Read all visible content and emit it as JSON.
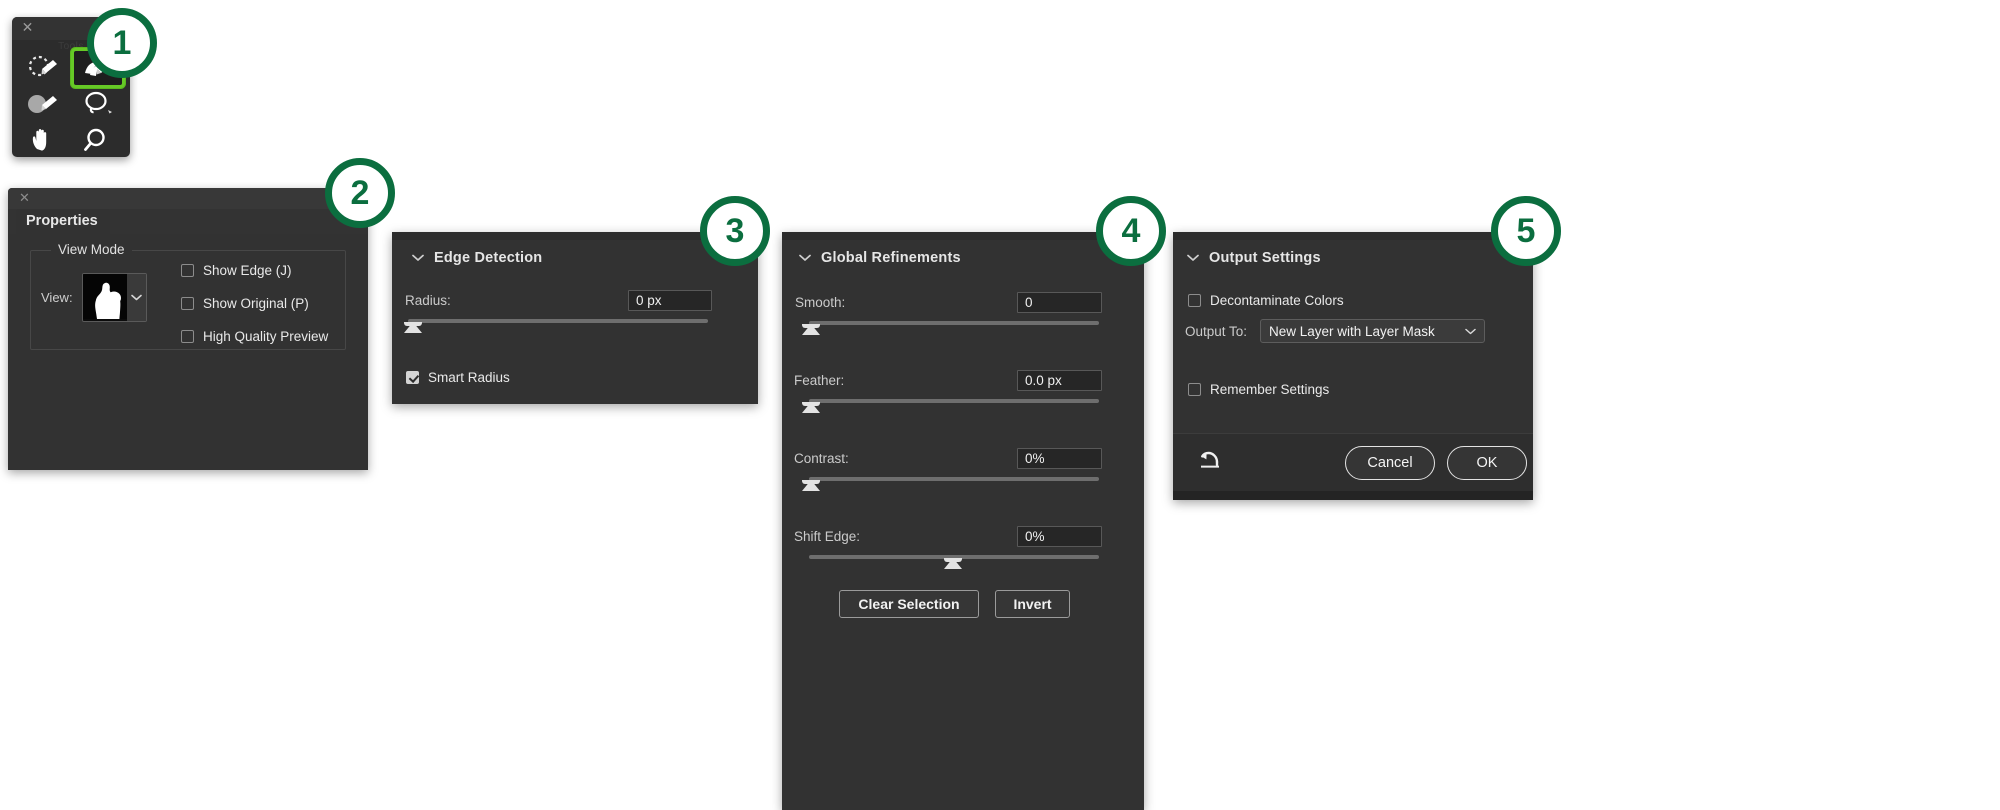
{
  "toolbar": {
    "title": "Tools",
    "close_icon": "close-icon",
    "collapse_icon": "chevron-left-icon",
    "tools": [
      {
        "name": "quick-selection-tool",
        "selected": false
      },
      {
        "name": "refine-edge-brush-tool",
        "selected": true
      },
      {
        "name": "brush-tool",
        "selected": false
      },
      {
        "name": "lasso-tool",
        "selected": false
      },
      {
        "name": "hand-tool",
        "selected": false
      },
      {
        "name": "zoom-tool",
        "selected": false
      }
    ]
  },
  "properties": {
    "close_icon": "close-icon",
    "tab_label": "Properties",
    "view_mode": {
      "legend": "View Mode",
      "view_label": "View:",
      "view_thumbnail": "onion-skin-mask-thumbnail",
      "caret_icon": "chevron-down-icon",
      "checkboxes": [
        {
          "label": "Show Edge (J)",
          "checked": false
        },
        {
          "label": "Show Original (P)",
          "checked": false
        },
        {
          "label": "High Quality Preview",
          "checked": false
        }
      ]
    }
  },
  "edge_detection": {
    "title": "Edge Detection",
    "disclosure_icon": "chevron-down-icon",
    "radius": {
      "label": "Radius:",
      "value": "0 px",
      "slider_percent": 0
    },
    "smart_radius": {
      "label": "Smart Radius",
      "checked": true
    }
  },
  "global_refinements": {
    "title": "Global Refinements",
    "disclosure_icon": "chevron-down-icon",
    "sliders": [
      {
        "label": "Smooth:",
        "value": "0",
        "slider_percent": 0
      },
      {
        "label": "Feather:",
        "value": "0.0 px",
        "slider_percent": 0
      },
      {
        "label": "Contrast:",
        "value": "0%",
        "slider_percent": 0
      },
      {
        "label": "Shift Edge:",
        "value": "0%",
        "slider_percent": 50
      }
    ],
    "buttons": {
      "clear_selection": "Clear Selection",
      "invert": "Invert"
    }
  },
  "output_settings": {
    "title": "Output Settings",
    "disclosure_icon": "chevron-down-icon",
    "decontaminate": {
      "label": "Decontaminate Colors",
      "checked": false
    },
    "output_to": {
      "label": "Output To:",
      "value": "New Layer with Layer Mask",
      "caret_icon": "chevron-down-icon"
    },
    "remember": {
      "label": "Remember Settings",
      "checked": false
    },
    "reset_icon": "reset-undo-icon",
    "cancel_label": "Cancel",
    "ok_label": "OK"
  },
  "badges": [
    {
      "label": "1"
    },
    {
      "label": "2"
    },
    {
      "label": "3"
    },
    {
      "label": "4"
    },
    {
      "label": "5"
    }
  ],
  "colors": {
    "accent_green": "#0b6e3f",
    "highlight_green": "#66c926",
    "panel_bg": "#323232",
    "page_bg": "#ffffff"
  }
}
